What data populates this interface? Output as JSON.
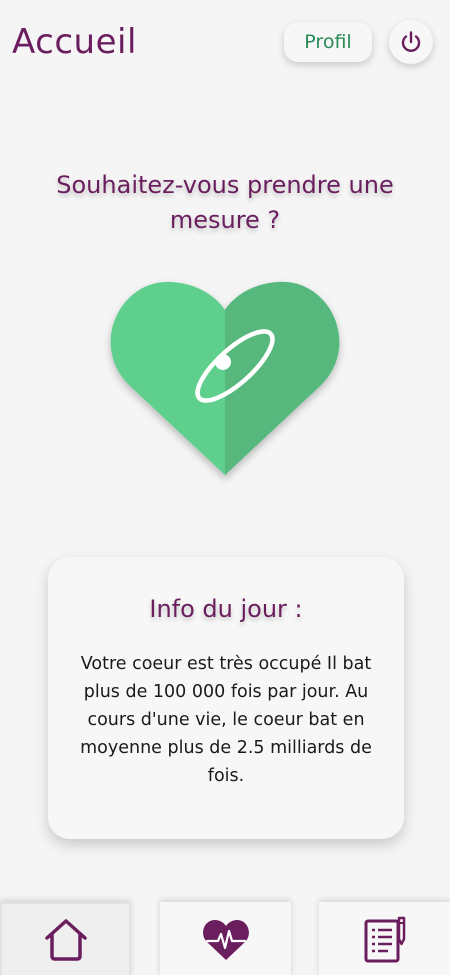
{
  "header": {
    "title": "Accueil",
    "profile_label": "Profil",
    "power_icon": "power-icon"
  },
  "main": {
    "question": "Souhaitez-vous prendre une mesure ?",
    "heart_icon": "heart-orbit-icon"
  },
  "info": {
    "title": "Info du jour :",
    "text": "Votre coeur est très occupé Il bat plus de 100 000 fois par jour. Au cours d'une vie, le coeur bat en moyenne plus de 2.5 milliards de fois."
  },
  "nav": {
    "items": [
      {
        "icon": "home-icon",
        "active": true
      },
      {
        "icon": "heart-pulse-icon",
        "active": false
      },
      {
        "icon": "journal-icon",
        "active": false
      }
    ]
  },
  "colors": {
    "primary": "#6b1e5e",
    "heart_light": "#5ecf8e",
    "heart_dark": "#56b87d",
    "profile_text": "#2a8a55",
    "background": "#f5f5f5"
  }
}
